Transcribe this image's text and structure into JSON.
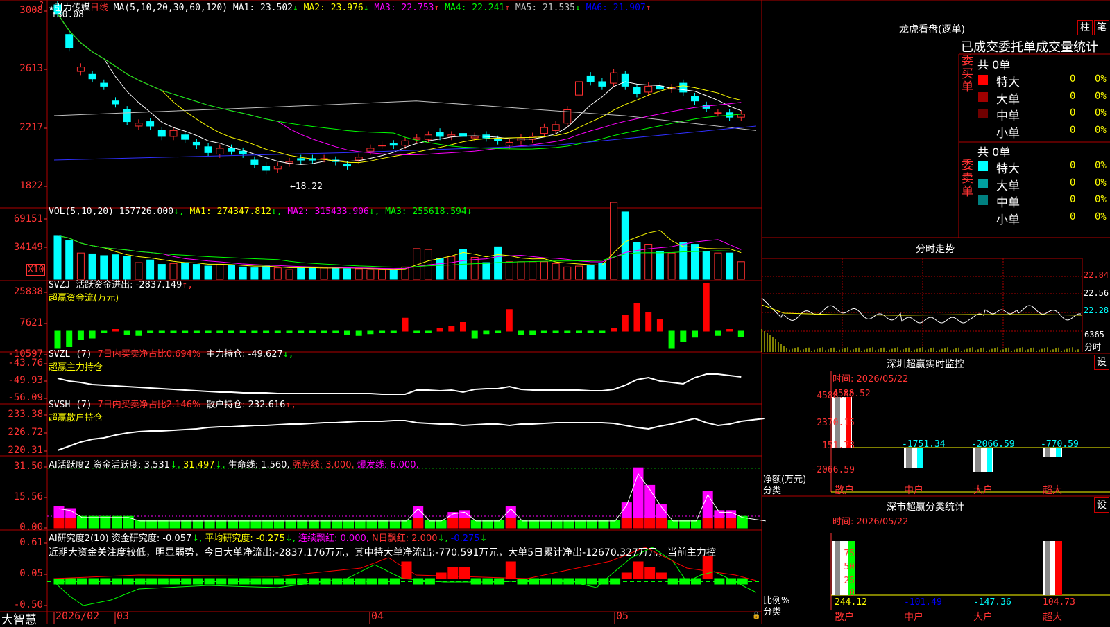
{
  "stock": {
    "name": "引力传媒",
    "period": "日线"
  },
  "main": {
    "ma_label": "MA(5,10,20,30,60,120)",
    "ma": [
      {
        "name": "MA1",
        "value": "23.502",
        "arrow": "↓",
        "color": "#ffffff"
      },
      {
        "name": "MA2",
        "value": "23.976",
        "arrow": "↓",
        "color": "#ffff00"
      },
      {
        "name": "MA3",
        "value": "22.753",
        "arrow": "↑",
        "color": "#ff00ff"
      },
      {
        "name": "MA4",
        "value": "22.241",
        "arrow": "↑",
        "color": "#00ff00"
      },
      {
        "name": "MA5",
        "value": "21.535",
        "arrow": "↓",
        "color": "#c0c0c0"
      },
      {
        "name": "MA6",
        "value": "21.907",
        "arrow": "↑",
        "color": "#0000ff"
      }
    ],
    "y_ticks": [
      "3008",
      "2613",
      "2217",
      "1822"
    ],
    "high_mark": "30.08",
    "low_mark": "18.22"
  },
  "vol": {
    "label": "VOL(5,10,20)",
    "value": "157726.000",
    "ma1": "MA1: 274347.812",
    "ma2": "MA2: 315433.906",
    "ma3": "MA3: 255618.594",
    "y_ticks": [
      "69151",
      "34149"
    ],
    "unit": "X10"
  },
  "svzj": {
    "label": "SVZJ",
    "desc": "活跃资金进出: -2837.149",
    "title": "超赢资金流(万元)",
    "y_ticks": [
      "25838",
      "7621",
      "-10597"
    ]
  },
  "svzl": {
    "label": "SVZL (7)",
    "desc": "7日内买卖净占比0.694%",
    "value": "主力持仓: -49.627",
    "title": "超赢主力持仓",
    "y_ticks": [
      "-43.76",
      "-49.93",
      "-56.09"
    ]
  },
  "svsh": {
    "label": "SVSH (7)",
    "desc": "7日内买卖净占比2.146%",
    "value": "散户持仓: 232.616",
    "title": "超赢散户持仓",
    "y_ticks": [
      "233.38",
      "226.72",
      "220.31"
    ]
  },
  "ai1": {
    "label": "AI活跃度2",
    "v1": "资金活跃度: 3.531",
    "v2": "31.497",
    "v3": "生命线: 1.560",
    "v4": "强势线: 3.000",
    "v5": "爆发线: 6.000",
    "y_ticks": [
      "31.50",
      "15.56",
      "0.00"
    ]
  },
  "ai2": {
    "label": "AI研究度2(10)",
    "v1": "资金研究度: -0.057",
    "v2": "平均研究度: -0.275",
    "v3": "连续飘红: 0.000",
    "v4": "N日飘红: 2.000",
    "v5": "-0.275",
    "text": "近期大资金关注度较低，明显弱势，今日大单净流出:-2837.176万元，其中特大单净流出:-770.591万元，大单5日累计净出-12670.327万元，当前主力控",
    "y_ticks": [
      "0.61",
      "0.05",
      "-0.50"
    ]
  },
  "xaxis": {
    "labels": [
      "2026/02",
      "03",
      "04",
      "05"
    ],
    "logo": "大智慧"
  },
  "longhu": {
    "title": "龙虎看盘(逐单)",
    "btn1": "柱",
    "btn2": "笔",
    "stat_title": "已成交委托单成交量统计",
    "buy": {
      "side": "委买单",
      "total": "共 0单",
      "rows": [
        {
          "name": "特大",
          "count": "0",
          "pct": "0%",
          "color": "#ff0000"
        },
        {
          "name": "大单",
          "count": "0",
          "pct": "0%",
          "color": "#a00000"
        },
        {
          "name": "中单",
          "count": "0",
          "pct": "0%",
          "color": "#700000"
        },
        {
          "name": "小单",
          "count": "0",
          "pct": "0%",
          "color": "#000000"
        }
      ]
    },
    "sell": {
      "side": "委卖单",
      "total": "共 0单",
      "rows": [
        {
          "name": "特大",
          "count": "0",
          "pct": "0%",
          "color": "#00ffff"
        },
        {
          "name": "大单",
          "count": "0",
          "pct": "0%",
          "color": "#00a0a0"
        },
        {
          "name": "中单",
          "count": "0",
          "pct": "0%",
          "color": "#008080"
        },
        {
          "name": "小单",
          "count": "0",
          "pct": "0%",
          "color": "#000000"
        }
      ]
    }
  },
  "intraday": {
    "title": "分时走势",
    "prices": [
      "22.84",
      "22.56",
      "22.28"
    ],
    "vol": "6365",
    "unit": "分时"
  },
  "monitor": {
    "title": "深圳超赢实时监控",
    "btn": "设",
    "time": "时间: 2026/05/22",
    "y_ticks": [
      "4588.52",
      "2370.15",
      "151.78",
      "-2066.59"
    ],
    "ylabel": "净额(万元)",
    "xlabel": "分类",
    "bars": [
      {
        "cat": "散户",
        "value": "4588.52"
      },
      {
        "cat": "中户",
        "value": "-1751.34"
      },
      {
        "cat": "大户",
        "value": "-2066.59"
      },
      {
        "cat": "超大",
        "value": "-770.59"
      }
    ]
  },
  "classify": {
    "title": "深市超赢分类统计",
    "btn": "设",
    "time": "时间: 2026/05/22",
    "y_ticks": [
      "75",
      "50",
      "25",
      "0"
    ],
    "ylabel": "比例%",
    "xlabel": "分类",
    "bars": [
      {
        "cat": "散户",
        "value": "244.12"
      },
      {
        "cat": "中户",
        "value": "-101.49"
      },
      {
        "cat": "大户",
        "value": "-147.36"
      },
      {
        "cat": "超大",
        "value": "104.73"
      }
    ]
  }
}
